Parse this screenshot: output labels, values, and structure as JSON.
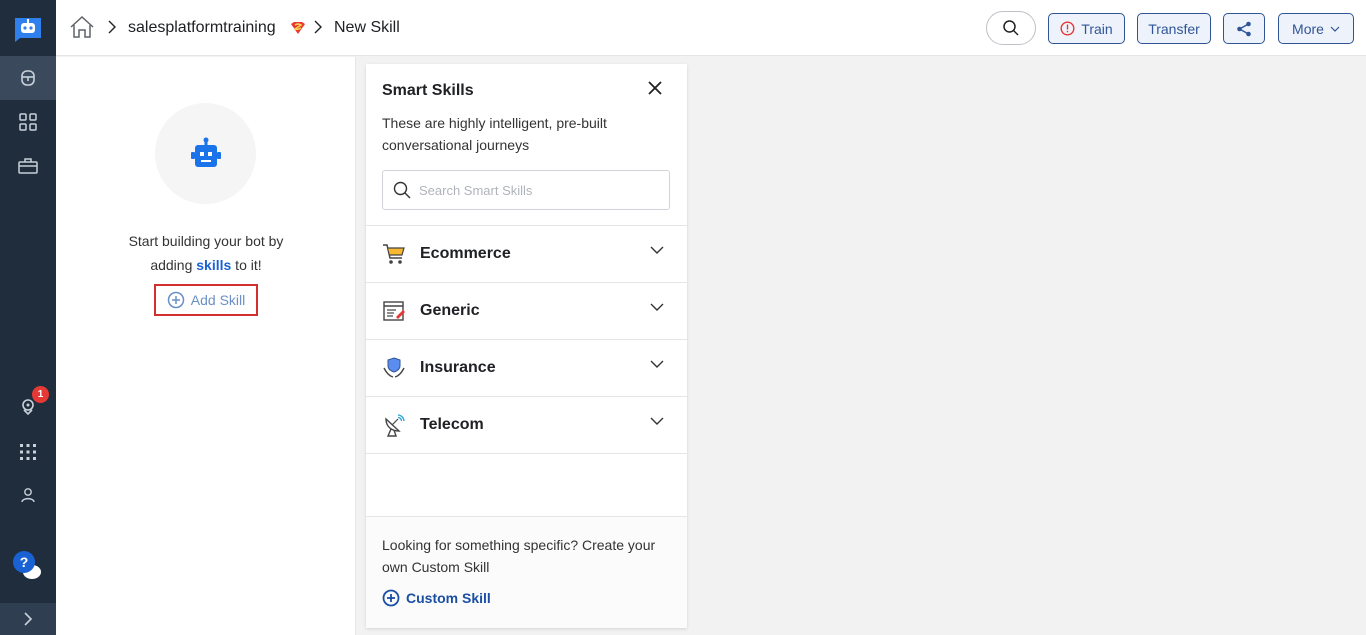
{
  "header": {
    "breadcrumb_bot": "salesplatformtraining",
    "breadcrumb_page": "New Skill",
    "buttons": {
      "train": "Train",
      "transfer": "Transfer",
      "more": "More"
    }
  },
  "rail": {
    "notification_count": "1",
    "help_glyph": "?"
  },
  "left_panel": {
    "intro_line1": "Start building your bot by",
    "intro_prefix": "adding ",
    "intro_link": "skills",
    "intro_suffix": " to it!",
    "add_skill": "Add Skill"
  },
  "smart_skills": {
    "title": "Smart Skills",
    "description": "These are highly intelligent, pre-built conversational journeys",
    "search_placeholder": "Search Smart Skills",
    "categories": [
      {
        "label": "Ecommerce",
        "icon": "shopping-cart-icon"
      },
      {
        "label": "Generic",
        "icon": "document-edit-icon"
      },
      {
        "label": "Insurance",
        "icon": "shield-hands-icon"
      },
      {
        "label": "Telecom",
        "icon": "satellite-dish-icon"
      }
    ],
    "footer_text": "Looking for something specific? Create your own Custom Skill",
    "custom_skill": "Custom Skill"
  },
  "colors": {
    "rail": "#1f2d3d",
    "accent": "#2f5597",
    "link": "#1a62d3",
    "highlight": "#d32f2f"
  }
}
